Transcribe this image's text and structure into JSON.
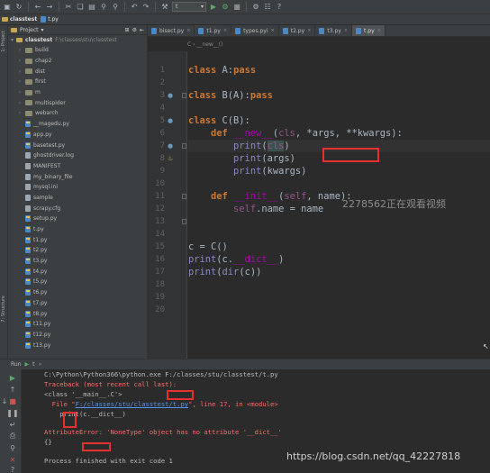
{
  "toolbar": {
    "run_config": "t"
  },
  "navbar": {
    "crumbs": [
      "classtest",
      "t.py"
    ]
  },
  "project": {
    "header": "Project",
    "root_name": "classtest",
    "root_path": "F:\\classes\\stu\\classtest",
    "items": [
      {
        "label": "build",
        "type": "folder"
      },
      {
        "label": "chap2",
        "type": "folder"
      },
      {
        "label": "dist",
        "type": "folder"
      },
      {
        "label": "first",
        "type": "folder"
      },
      {
        "label": "m",
        "type": "folder"
      },
      {
        "label": "multispider",
        "type": "folder"
      },
      {
        "label": "webarch",
        "type": "folder"
      },
      {
        "label": "__magedu.py",
        "type": "py"
      },
      {
        "label": "app.py",
        "type": "py"
      },
      {
        "label": "basetest.py",
        "type": "py"
      },
      {
        "label": "ghostdriver.log",
        "type": "txt"
      },
      {
        "label": "MANIFEST",
        "type": "txt"
      },
      {
        "label": "my_binary_file",
        "type": "txt"
      },
      {
        "label": "mysql.ini",
        "type": "txt"
      },
      {
        "label": "sample",
        "type": "txt"
      },
      {
        "label": "scrapy.cfg",
        "type": "txt"
      },
      {
        "label": "setup.py",
        "type": "py"
      },
      {
        "label": "t.py",
        "type": "py"
      },
      {
        "label": "t1.py",
        "type": "py"
      },
      {
        "label": "t2.py",
        "type": "py"
      },
      {
        "label": "t3.py",
        "type": "py"
      },
      {
        "label": "t4.py",
        "type": "py"
      },
      {
        "label": "t5.py",
        "type": "py"
      },
      {
        "label": "t6.py",
        "type": "py"
      },
      {
        "label": "t7.py",
        "type": "py"
      },
      {
        "label": "t8.py",
        "type": "py"
      },
      {
        "label": "t11.py",
        "type": "py"
      },
      {
        "label": "t12.py",
        "type": "py"
      },
      {
        "label": "t13.py",
        "type": "py"
      }
    ]
  },
  "tabs": [
    {
      "label": "bisect.py",
      "active": false
    },
    {
      "label": "t1.py",
      "active": false
    },
    {
      "label": "types.pyi",
      "active": false
    },
    {
      "label": "t2.py",
      "active": false
    },
    {
      "label": "t3.py",
      "active": false
    },
    {
      "label": "t.py",
      "active": true
    }
  ],
  "editor": {
    "breadcrumb": "C  ›  __new__()",
    "line_numbers": [
      "1",
      "2",
      "3",
      "4",
      "5",
      "6",
      "7",
      "8",
      "9",
      "10",
      "11",
      "12",
      "13",
      "14",
      "15",
      "16",
      "17",
      "18",
      "19",
      "20"
    ]
  },
  "run_panel": {
    "run_label": "Run",
    "config": "t"
  },
  "console": {
    "cmd": "C:\\Python\\Python366\\python.exe F:/classes/stu/classtest/t.py",
    "traceback": "Traceback (most recent call last):",
    "cls_out": "<class '__main__.C'>",
    "file_prefix": "  File \"",
    "file_link": "F:/classes/stu/classtest/t.py",
    "file_suffix": "\", line 17, in <module>",
    "src_line": "    print(c.__dict__)",
    "error": "AttributeError: 'NoneType' object has no attribute '__dict__'",
    "braces": "{}",
    "exit": "Process finished with exit code 1"
  },
  "watermarks": {
    "viewers": "2278562正在观看视频",
    "blog": "https://blog.csdn.net/qq_42227818"
  }
}
